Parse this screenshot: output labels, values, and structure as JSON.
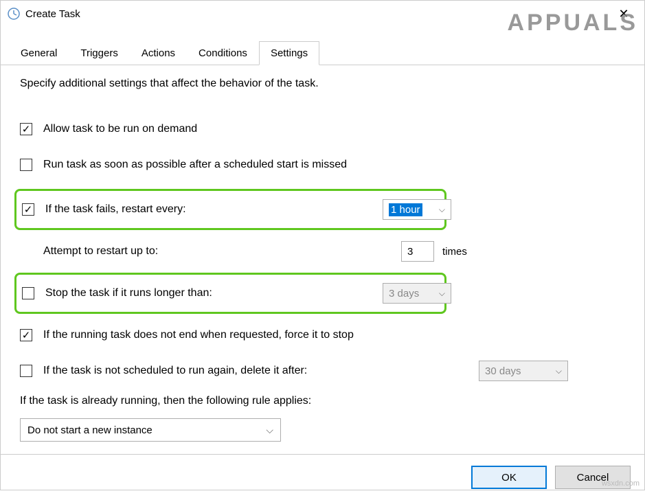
{
  "window": {
    "title": "Create Task"
  },
  "watermark": "APPUALS",
  "watermark_small": "wsxdn.com",
  "tabs": {
    "general": "General",
    "triggers": "Triggers",
    "actions": "Actions",
    "conditions": "Conditions",
    "settings": "Settings"
  },
  "settings": {
    "description": "Specify additional settings that affect the behavior of the task.",
    "allow_demand": "Allow task to be run on demand",
    "run_asap": "Run task as soon as possible after a scheduled start is missed",
    "restart_label": "If the task fails, restart every:",
    "restart_value": "1 hour",
    "attempt_label": "Attempt to restart up to:",
    "attempt_value": "3",
    "attempt_suffix": "times",
    "stop_longer_label": "Stop the task if it runs longer than:",
    "stop_longer_value": "3 days",
    "force_stop": "If the running task does not end when requested, force it to stop",
    "delete_after_label": "If the task is not scheduled to run again, delete it after:",
    "delete_after_value": "30 days",
    "rule_label": "If the task is already running, then the following rule applies:",
    "rule_value": "Do not start a new instance"
  },
  "buttons": {
    "ok": "OK",
    "cancel": "Cancel"
  }
}
